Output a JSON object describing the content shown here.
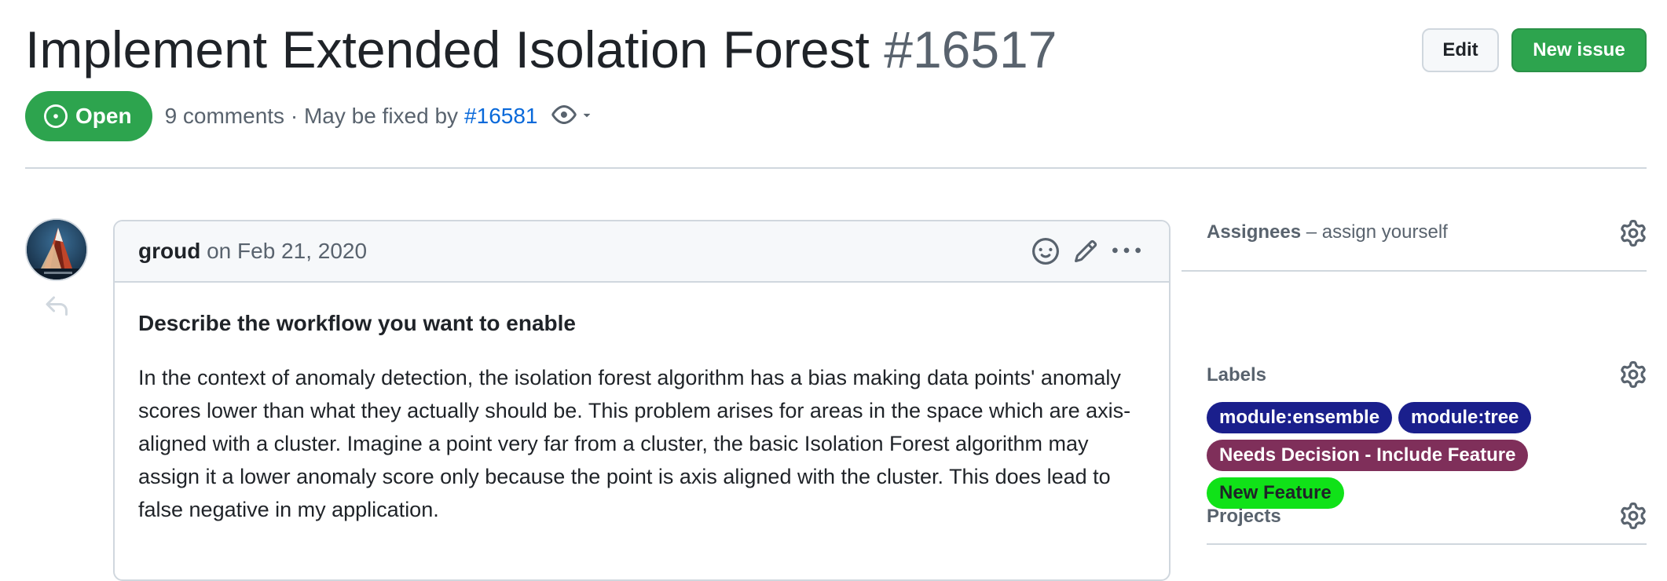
{
  "header": {
    "title": "Implement Extended Isolation Forest",
    "number": "#16517",
    "edit_label": "Edit",
    "new_issue_label": "New issue"
  },
  "meta": {
    "state": "Open",
    "summary": "9 comments · May be fixed by",
    "linked_pr": "#16581"
  },
  "comment": {
    "author": "groud",
    "date_text": "on Feb 21, 2020",
    "heading": "Describe the workflow you want to enable",
    "body": "In the context of anomaly detection, the isolation forest algorithm has a bias making data points' anomaly scores lower than what they actually should be. This problem arises for areas in the space which are axis-aligned with a cluster. Imagine a point very far from a cluster, the basic Isolation Forest algorithm may assign it a lower anomaly score only because the point is axis aligned with the cluster. This does lead to false negative in my application."
  },
  "sidebar": {
    "assignees": {
      "title": "Assignees",
      "subtitle": "– assign yourself"
    },
    "labels": {
      "title": "Labels",
      "items": [
        {
          "text": "module:ensemble",
          "bg": "#1a1f8c",
          "fg": "#ffffff"
        },
        {
          "text": "module:tree",
          "bg": "#1a1f8c",
          "fg": "#ffffff"
        },
        {
          "text": "Needs Decision - Include Feature",
          "bg": "#7f2f5a",
          "fg": "#ffffff"
        },
        {
          "text": "New Feature",
          "bg": "#10e218",
          "fg": "#1f2328"
        }
      ]
    },
    "projects": {
      "title": "Projects"
    }
  },
  "colors": {
    "open_green": "#2da44e",
    "link_blue": "#0969da",
    "muted": "#59636e",
    "border": "#d0d7de"
  }
}
